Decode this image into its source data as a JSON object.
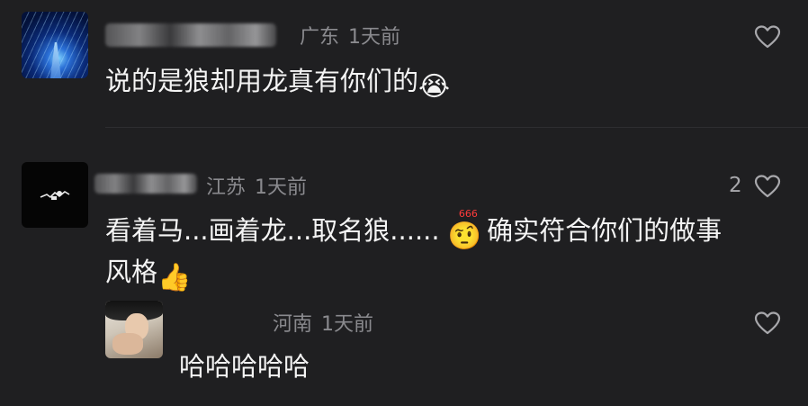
{
  "comments": [
    {
      "location": "广东",
      "time": "1天前",
      "text": "说的是狼却用龙真有你们的",
      "emoji": "😭"
    },
    {
      "location": "江苏",
      "time": "1天前",
      "likes": "2",
      "text_line1": "看着马...画着龙...取名狼......",
      "emoji": "🤨",
      "emoji_tag": "666",
      "text_line1_b": "确实符合你们的做事",
      "text_line2": "风格",
      "emoji2": "👍"
    }
  ],
  "reply": {
    "location": "河南",
    "time": "1天前",
    "text": "哈哈哈哈哈"
  },
  "icons": {
    "like": "heart-outline-icon"
  },
  "colors": {
    "background": "#1f1f21",
    "text": "#f4f4f4",
    "meta": "#8a8a8e"
  }
}
